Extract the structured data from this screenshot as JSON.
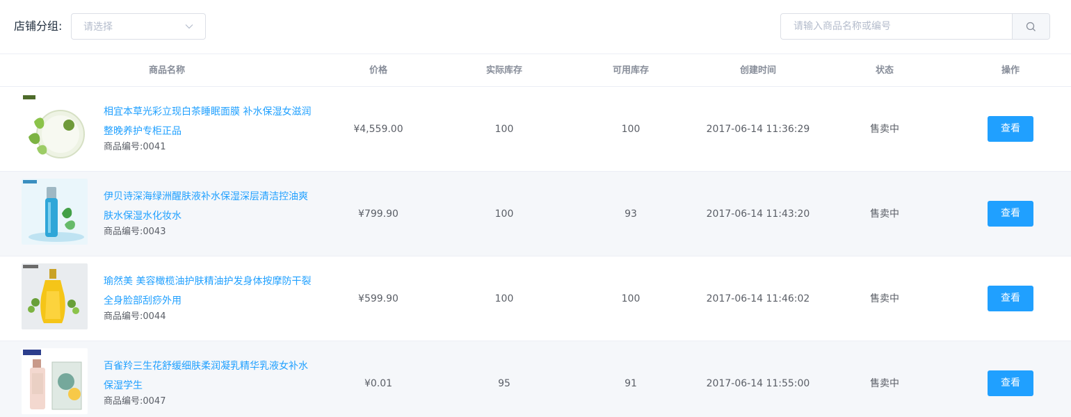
{
  "filter": {
    "label": "店铺分组:",
    "placeholder": "请选择"
  },
  "search": {
    "placeholder": "请输入商品名称或编号"
  },
  "columns": {
    "name": "商品名称",
    "price": "价格",
    "stock": "实际库存",
    "available": "可用库存",
    "created": "创建时间",
    "status": "状态",
    "action": "操作"
  },
  "rows": [
    {
      "name": "相宜本草光彩立现白茶睡眠面膜 补水保湿女滋润整晚养护专柜正品",
      "code": "商品编号:0041",
      "price": "¥4,559.00",
      "stock": "100",
      "available": "100",
      "created": "2017-06-14 11:36:29",
      "status": "售卖中",
      "action": "查看"
    },
    {
      "name": "伊贝诗深海绿洲醒肤液补水保湿深层清洁控油爽肤水保湿水化妆水",
      "code": "商品编号:0043",
      "price": "¥799.90",
      "stock": "100",
      "available": "93",
      "created": "2017-06-14 11:43:20",
      "status": "售卖中",
      "action": "查看"
    },
    {
      "name": "瑜然美 美容橄榄油护肤精油护发身体按摩防干裂全身脸部刮痧外用",
      "code": "商品编号:0044",
      "price": "¥599.90",
      "stock": "100",
      "available": "100",
      "created": "2017-06-14 11:46:02",
      "status": "售卖中",
      "action": "查看"
    },
    {
      "name": "百雀羚三生花舒缓细肤柔润凝乳精华乳液女补水保湿学生",
      "code": "商品编号:0047",
      "price": "¥0.01",
      "stock": "95",
      "available": "91",
      "created": "2017-06-14 11:55:00",
      "status": "售卖中",
      "action": "查看"
    }
  ],
  "colors": {
    "primary": "#20a0ff",
    "stripe": "#f5f7fa",
    "border": "#ebeef5"
  }
}
